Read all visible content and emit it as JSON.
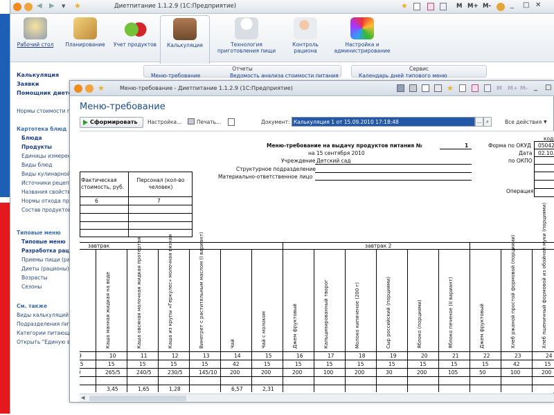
{
  "window": {
    "title": "Диетпитание 1.1.2.9 (1С:Предприятие)",
    "controls": [
      "M",
      "M+",
      "M-"
    ]
  },
  "ribbon": {
    "items": [
      {
        "label": "Рабочий стол",
        "icon": "desk-lamp-icon"
      },
      {
        "label": "Планирование",
        "icon": "pencil-ruler-icon"
      },
      {
        "label": "Учет продуктов",
        "icon": "apples-icon"
      },
      {
        "label": "Калькуляция",
        "icon": "cooking-pot-icon"
      },
      {
        "label": "Технология приготовления пищи",
        "icon": "chef-icon"
      },
      {
        "label": "Контроль рациона",
        "icon": "doctor-microscope-icon"
      },
      {
        "label": "Настройка и администрирование",
        "icon": "monitor-settings-icon"
      }
    ]
  },
  "groups": {
    "reports": {
      "title": "Отчеты",
      "items": [
        "Меню-требование",
        "Ведомость анализа стоимости питания"
      ]
    },
    "service": {
      "title": "Сервис",
      "items": [
        "Календарь дней типового меню"
      ]
    }
  },
  "sidebar": {
    "items": [
      {
        "label": "Калькуляция",
        "style": "h"
      },
      {
        "label": "Заявки",
        "style": "h"
      },
      {
        "label": "Помощник диетолога",
        "style": "h"
      },
      {
        "label": "Нормы стоимости питания",
        "style": "l"
      },
      {
        "label": "Картотека блюд",
        "style": "g"
      },
      {
        "label": "Блюда",
        "style": "b"
      },
      {
        "label": "Продукты",
        "style": "b"
      },
      {
        "label": "Единицы измерения",
        "style": "n"
      },
      {
        "label": "Виды блюд",
        "style": "n"
      },
      {
        "label": "Виды кулинарной обработки",
        "style": "n"
      },
      {
        "label": "Источники рецептур",
        "style": "n"
      },
      {
        "label": "Названия свойств",
        "style": "n"
      },
      {
        "label": "Нормы отхода продуктов",
        "style": "n"
      },
      {
        "label": "Состав продуктов",
        "style": "n"
      },
      {
        "label": "Типовые меню",
        "style": "g"
      },
      {
        "label": "Типовые меню",
        "style": "b"
      },
      {
        "label": "Разработка рациона",
        "style": "b"
      },
      {
        "label": "Приемы пищи (рационы)",
        "style": "n"
      },
      {
        "label": "Диеты (рационы)",
        "style": "n"
      },
      {
        "label": "Возрасты",
        "style": "n"
      },
      {
        "label": "Сезоны",
        "style": "n"
      },
      {
        "label": "См. также",
        "style": "g"
      },
      {
        "label": "Виды калькуляций",
        "style": "l"
      },
      {
        "label": "Подразделения питания",
        "style": "l"
      },
      {
        "label": "Категории питающихся",
        "style": "l"
      },
      {
        "label": "Открыть \"Единую ведомость\"",
        "style": "l"
      }
    ]
  },
  "doc": {
    "window_title": "Меню-требование - Диетпитание 1.1.2.9 (1С:Предприятие)",
    "window_controls": [
      "M",
      "M+",
      "M-"
    ],
    "heading": "Меню-требование",
    "toolbar": {
      "generate": "Сформировать",
      "settings": "Настройка...",
      "print": "Печать...",
      "document_label": "Документ:",
      "document_value": "Калькуляция 1 от 15.09.2010 17:18:48",
      "all_actions": "Все действия"
    }
  },
  "sheet": {
    "header_title": "Меню-требование на выдачу продуктов питания №",
    "doc_number": "1",
    "date_line": "на 15 сентября 2010",
    "institution_label": "Учреждение",
    "institution": "Детский сад",
    "division_label": "Структурное подразделение",
    "responsible_label": "Материально-ответственное лицо",
    "codes_label": "коды",
    "okud_label": "Форма по ОКУД",
    "okud": "05042",
    "date_label": "Дата",
    "date_code": "02.10.",
    "okpo_label": "по ОКПО",
    "operation_label": "Операция",
    "left_table": {
      "h1": "Фактическая стоимость, руб.",
      "h2": "Персонал (кол-во человек)",
      "n1": "6",
      "n2": "7"
    },
    "meals": [
      "завтрак",
      "завтрак 2"
    ],
    "columns": [
      {
        "name": "Сыр голландский (порциями)",
        "num": "9",
        "r1": "15",
        "r2": "30",
        "r3": ""
      },
      {
        "name": "Каша манная жидкая на воде",
        "num": "10",
        "r1": "15",
        "r2": "265/5",
        "r3": "3,45"
      },
      {
        "name": "Каша овсяная молочная жидкая протертая",
        "num": "11",
        "r1": "15",
        "r2": "240/5",
        "r3": "1,65"
      },
      {
        "name": "Каша из крупы «Геркулес» молочная вязкая",
        "num": "12",
        "r1": "15",
        "r2": "230/5",
        "r3": "1,28"
      },
      {
        "name": "Винегрет с растительным маслом (I вариант)",
        "num": "13",
        "r1": "15",
        "r2": "145/10",
        "r3": ""
      },
      {
        "name": "Чай",
        "num": "14",
        "r1": "42",
        "r2": "200",
        "r3": "6,57"
      },
      {
        "name": "Чай с молоком",
        "num": "15",
        "r1": "15",
        "r2": "200",
        "r3": "2,31"
      },
      {
        "name": "Джем фруктовый",
        "num": "16",
        "r1": "15",
        "r2": "200",
        "r3": ""
      },
      {
        "name": "Кальцинированный творог",
        "num": "17",
        "r1": "15",
        "r2": "100",
        "r3": ""
      },
      {
        "name": "Молоко кипяченое (200 г)",
        "num": "18",
        "r1": "15",
        "r2": "200",
        "r3": ""
      },
      {
        "name": "Сыр российский (порциями)",
        "num": "19",
        "r1": "15",
        "r2": "30",
        "r3": ""
      },
      {
        "name": "Яблоко (порциями)",
        "num": "20",
        "r1": "15",
        "r2": "200",
        "r3": ""
      },
      {
        "name": "Яблоко печеное (II вариант)",
        "num": "21",
        "r1": "15",
        "r2": "105",
        "r3": ""
      },
      {
        "name": "Джем фруктовый",
        "num": "22",
        "r1": "15",
        "r2": "50",
        "r3": ""
      },
      {
        "name": "Хлеб ржаной простой формовой (порциями)",
        "num": "23",
        "r1": "42",
        "r2": "100",
        "r3": ""
      },
      {
        "name": "Хлеб пшеничный формовой из обойной муки (порциями)",
        "num": "24",
        "r1": "15",
        "r2": "200",
        "r3": ""
      }
    ]
  }
}
